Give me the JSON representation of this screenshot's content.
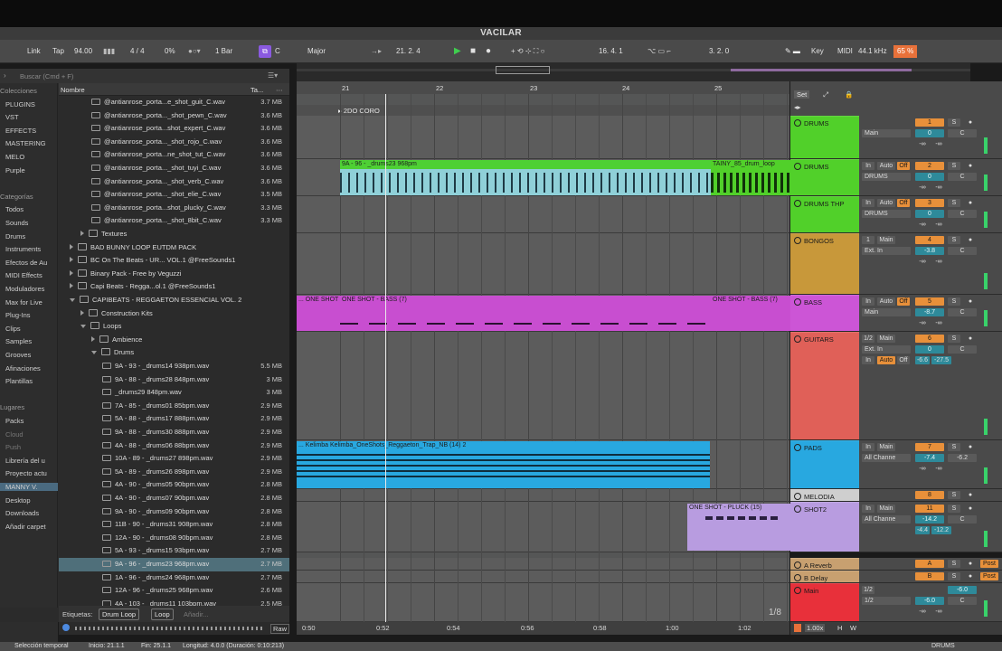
{
  "window": {
    "title": "VACILAR"
  },
  "transport": {
    "link": "Link",
    "tap": "Tap",
    "tempo": "94.00",
    "signature": "4 / 4",
    "groove": "0%",
    "quantize": "1 Bar",
    "key": "C",
    "scale": "Major",
    "position": "21. 2. 4",
    "loop_start": "16. 4. 1",
    "loop_length": "3. 2. 0",
    "key_label": "Key",
    "midi_label": "MIDI",
    "sample_rate": "44.1 kHz",
    "cpu": "65 %"
  },
  "browser": {
    "search_placeholder": "Buscar (Cmd + F)",
    "col_name": "Nombre",
    "col_size": "Ta...",
    "places_header": "Colecciones",
    "categories_header": "Categorías",
    "places2_header": "Lugares",
    "collections": [
      "PLUGINS",
      "VST",
      "EFFECTS",
      "MASTERING",
      "MELO",
      "Purple"
    ],
    "categories": [
      "Todos",
      "Sounds",
      "Drums",
      "Instruments",
      "Efectos de Au",
      "MIDI Effects",
      "Moduladores",
      "Max for Live",
      "Plug-Ins",
      "Clips",
      "Samples",
      "Grooves",
      "Afinaciones",
      "Plantillas"
    ],
    "places": [
      "Packs",
      "Cloud",
      "Push",
      "Librería del u",
      "Proyecto actu",
      "MANNY V.",
      "Desktop",
      "Downloads",
      "Añadir carpet"
    ],
    "files": [
      {
        "name": "@antianrose_porta...e_shot_guit_C.wav",
        "size": "3.7 MB",
        "kind": "file",
        "indent": 2
      },
      {
        "name": "@antianrose_porta..._shot_pewn_C.wav",
        "size": "3.6 MB",
        "kind": "file",
        "indent": 2
      },
      {
        "name": "@antianrose_porta...shot_expert_C.wav",
        "size": "3.6 MB",
        "kind": "file",
        "indent": 2
      },
      {
        "name": "@antianrose_porta..._shot_rojo_C.wav",
        "size": "3.6 MB",
        "kind": "file",
        "indent": 2
      },
      {
        "name": "@antianrose_porta...ne_shot_tut_C.wav",
        "size": "3.6 MB",
        "kind": "file",
        "indent": 2
      },
      {
        "name": "@antianrose_porta..._shot_tuyi_C.wav",
        "size": "3.6 MB",
        "kind": "file",
        "indent": 2
      },
      {
        "name": "@antianrose_porta..._shot_verb_C.wav",
        "size": "3.6 MB",
        "kind": "file",
        "indent": 2
      },
      {
        "name": "@antianrose_porta..._shot_elie_C.wav",
        "size": "3.5 MB",
        "kind": "file",
        "indent": 2
      },
      {
        "name": "@antianrose_porta...shot_plucky_C.wav",
        "size": "3.3 MB",
        "kind": "file",
        "indent": 2
      },
      {
        "name": "@antianrose_porta..._shot_8bit_C.wav",
        "size": "3.3 MB",
        "kind": "file",
        "indent": 2
      },
      {
        "name": "Textures",
        "size": "",
        "kind": "folder",
        "indent": 1
      },
      {
        "name": "BAD BUNNY LOOP EUTDM PACK",
        "size": "",
        "kind": "folder",
        "indent": 0
      },
      {
        "name": "BC On The Beats - UR... VOL.1 @FreeSounds1",
        "size": "",
        "kind": "folder",
        "indent": 0
      },
      {
        "name": "Binary Pack - Free by Veguzzi",
        "size": "",
        "kind": "folder",
        "indent": 0
      },
      {
        "name": "Capi Beats - Regga...ol.1 @FreeSounds1",
        "size": "",
        "kind": "folder",
        "indent": 0
      },
      {
        "name": "CAPIBEATS - REGGAETON ESSENCIAL VOL. 2",
        "size": "",
        "kind": "folder-open",
        "indent": 0
      },
      {
        "name": "Construction Kits",
        "size": "",
        "kind": "folder",
        "indent": 1
      },
      {
        "name": "Loops",
        "size": "",
        "kind": "folder-open",
        "indent": 1
      },
      {
        "name": "Ambience",
        "size": "",
        "kind": "folder",
        "indent": 2
      },
      {
        "name": "Drums",
        "size": "",
        "kind": "folder-open",
        "indent": 2
      },
      {
        "name": "9A - 93 - _drums14 938pm.wav",
        "size": "5.5 MB",
        "kind": "file",
        "indent": 3
      },
      {
        "name": "9A - 88 - _drums28 848pm.wav",
        "size": "3 MB",
        "kind": "file",
        "indent": 3
      },
      {
        "name": "_drums29 848pm.wav",
        "size": "3 MB",
        "kind": "file",
        "indent": 3
      },
      {
        "name": "7A - 85 - _drums01 85bpm.wav",
        "size": "2.9 MB",
        "kind": "file",
        "indent": 3
      },
      {
        "name": "5A - 88 - _drums17 888pm.wav",
        "size": "2.9 MB",
        "kind": "file",
        "indent": 3
      },
      {
        "name": "9A - 88 - _drums30 888pm.wav",
        "size": "2.9 MB",
        "kind": "file",
        "indent": 3
      },
      {
        "name": "4A - 88 - _drums06 88bpm.wav",
        "size": "2.9 MB",
        "kind": "file",
        "indent": 3
      },
      {
        "name": "10A - 89 - _drums27 898pm.wav",
        "size": "2.9 MB",
        "kind": "file",
        "indent": 3
      },
      {
        "name": "5A - 89 - _drums26 898pm.wav",
        "size": "2.9 MB",
        "kind": "file",
        "indent": 3
      },
      {
        "name": "4A - 90 - _drums05 90bpm.wav",
        "size": "2.8 MB",
        "kind": "file",
        "indent": 3
      },
      {
        "name": "4A - 90 - _drums07 90bpm.wav",
        "size": "2.8 MB",
        "kind": "file",
        "indent": 3
      },
      {
        "name": "9A - 90 - _drums09 90bpm.wav",
        "size": "2.8 MB",
        "kind": "file",
        "indent": 3
      },
      {
        "name": "11B - 90 - _drums31 908pm.wav",
        "size": "2.8 MB",
        "kind": "file",
        "indent": 3
      },
      {
        "name": "12A - 90 - _drums08 90bpm.wav",
        "size": "2.8 MB",
        "kind": "file",
        "indent": 3
      },
      {
        "name": "5A - 93 - _drums15 93bpm.wav",
        "size": "2.7 MB",
        "kind": "file",
        "indent": 3
      },
      {
        "name": "9A - 96 - _drums23 968pm.wav",
        "size": "2.7 MB",
        "kind": "file",
        "indent": 3,
        "selected": true
      },
      {
        "name": "1A - 96 - _drums24 968pm.wav",
        "size": "2.7 MB",
        "kind": "file",
        "indent": 3
      },
      {
        "name": "12A - 96 - _drums25 968pm.wav",
        "size": "2.6 MB",
        "kind": "file",
        "indent": 3
      },
      {
        "name": "4A - 103 - _drums11 103bpm.wav",
        "size": "2.5 MB",
        "kind": "file",
        "indent": 3
      }
    ],
    "tags_label": "Etiquetas:",
    "tags": [
      "Drum Loop",
      "Loop"
    ],
    "tags_add": "Añadir...",
    "raw": "Raw"
  },
  "arrangement": {
    "bars": [
      "21",
      "22",
      "23",
      "24",
      "25"
    ],
    "locator": "2DO CORO",
    "times": [
      "0:50",
      "0:52",
      "0:54",
      "0:56",
      "0:58",
      "1:00",
      "1:02"
    ],
    "zoom": "1/8",
    "clips": {
      "drums_a": "9A - 96 - _drums23 968pm",
      "drums_b": "TAINY_85_drum_loop",
      "bass_a": "... ONE SHOT",
      "bass_b": "ONE SHOT - BASS  (7)",
      "bass_c": "ONE SHOT - BASS  (7)",
      "pads": "... Kelimba   Kelimba_OneShots_Reggaeton_Trap_NB (14) 2",
      "pluck": "ONE SHOT - PLUCK (15)"
    }
  },
  "set_label": "Set",
  "tracks": [
    {
      "name": "DRUMS",
      "color": "#51d02a",
      "num": "1",
      "vol": "0",
      "pan": "C",
      "in": "Main",
      "t1": "",
      "t2": ""
    },
    {
      "name": "DRUMS",
      "color": "#51d02a",
      "num": "2",
      "vol": "0",
      "pan": "C",
      "in": "DRUMS",
      "t1": "In",
      "t2": "Auto"
    },
    {
      "name": "DRUMS THP",
      "color": "#51d02a",
      "num": "3",
      "vol": "0",
      "pan": "C",
      "in": "DRUMS",
      "t1": "In",
      "t2": "Auto"
    },
    {
      "name": "BONGOS",
      "color": "#c8983a",
      "num": "4",
      "vol": "-3.8",
      "pan": "C",
      "in": "Ext. In",
      "t1": "1",
      "t2": "Main"
    },
    {
      "name": "BASS",
      "color": "#cc55d6",
      "num": "5",
      "vol": "-8.7",
      "pan": "C",
      "in": "Main",
      "t1": "In",
      "t2": "Auto"
    },
    {
      "name": "GUITARS",
      "color": "#e06058",
      "num": "6",
      "vol": "0",
      "pan": "C",
      "in": "Ext. In",
      "t1": "1/2",
      "t2": "Main"
    },
    {
      "name": "PADS",
      "color": "#28a8e0",
      "num": "7",
      "vol": "-7.4",
      "pan": "-6.2",
      "in": "All Channe",
      "t1": "In",
      "t2": "Main"
    },
    {
      "name": "MELODIA",
      "color": "#cfcfcf",
      "num": "8",
      "vol": "",
      "pan": "",
      "in": "",
      "t1": "",
      "t2": ""
    },
    {
      "name": "SHOT2",
      "color": "#b89ce0",
      "num": "11",
      "vol": "-14.2",
      "pan": "C",
      "in": "All Channe",
      "t1": "In",
      "t2": "Main"
    },
    {
      "name": "A Reverb",
      "color": "#c8a070",
      "num": "A",
      "vol": "",
      "pan": "",
      "in": "",
      "t1": "",
      "t2": ""
    },
    {
      "name": "B Delay",
      "color": "#c8a070",
      "num": "B",
      "vol": "",
      "pan": "",
      "in": "",
      "t1": "",
      "t2": ""
    },
    {
      "name": "Main",
      "color": "#e8303a",
      "num": "",
      "vol": "-6.0",
      "pan": "C",
      "in": "1/2",
      "t1": "1/2",
      "t2": ""
    }
  ],
  "mixer_labels": {
    "solo": "S",
    "auto": "Auto",
    "off": "Off",
    "in": "In",
    "post": "Post",
    "inf": "-∞",
    "extra_vol": "-27.5",
    "extra_vol2": "-6.6",
    "extra_pan": "-12.2",
    "extra_pan2": "-4.4",
    "main_extra": "-6.0"
  },
  "status": {
    "selection": "Selección temporal",
    "start": "Inicio: 21.1.1",
    "end": "Fin: 25.1.1",
    "length": "Longitud: 4.0.0 (Duración: 0:10:213)",
    "track": "DRUMS"
  },
  "bottom_zoom": "1.00x"
}
